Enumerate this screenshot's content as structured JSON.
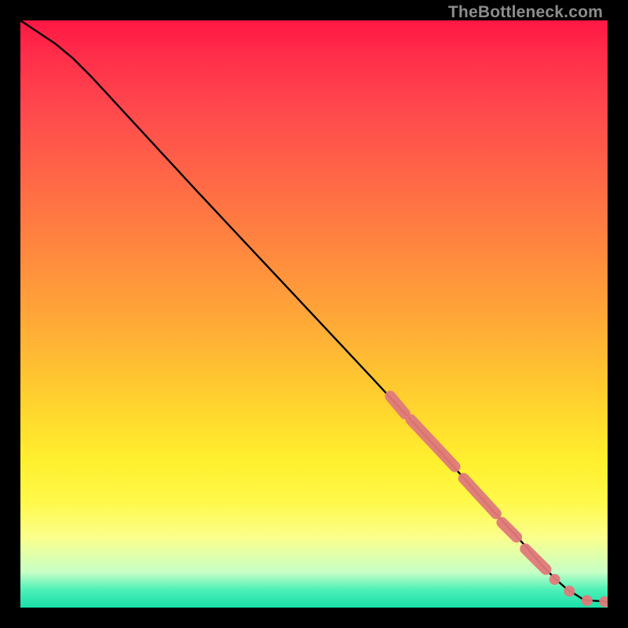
{
  "watermark": "TheBottleneck.com",
  "chart_data": {
    "type": "line",
    "title": "",
    "xlabel": "",
    "ylabel": "",
    "xlim": [
      0,
      100
    ],
    "ylim": [
      0,
      100
    ],
    "grid": false,
    "legend": false,
    "curve": {
      "x": [
        0,
        3,
        6,
        9,
        12,
        18,
        30,
        45,
        60,
        72,
        80,
        86,
        89,
        91,
        93,
        96,
        100
      ],
      "y": [
        100,
        98,
        96,
        93.5,
        90.5,
        84,
        71,
        55,
        39,
        26,
        17,
        10.5,
        7,
        5,
        3.2,
        1.3,
        1.0
      ]
    },
    "marker_clusters": [
      {
        "x_start": 63,
        "x_end": 65.5,
        "y_start": 36,
        "y_end": 33,
        "count": 6
      },
      {
        "x_start": 66.5,
        "x_end": 74,
        "y_start": 32,
        "y_end": 24,
        "count": 12
      },
      {
        "x_start": 75.5,
        "x_end": 81,
        "y_start": 22,
        "y_end": 16,
        "count": 8
      },
      {
        "x_start": 82,
        "x_end": 84.5,
        "y_start": 14.5,
        "y_end": 12,
        "count": 5
      },
      {
        "x_start": 86,
        "x_end": 89.5,
        "y_start": 10,
        "y_end": 6.5,
        "count": 5
      }
    ],
    "tail_markers": [
      {
        "x": 91,
        "y": 4.8
      },
      {
        "x": 93.5,
        "y": 2.8
      },
      {
        "x": 96.5,
        "y": 1.2
      },
      {
        "x": 99.5,
        "y": 1.0
      }
    ],
    "colors": {
      "line": "#000000",
      "marker_fill": "#e07a7a",
      "marker_stroke": "#b54d4d"
    }
  }
}
